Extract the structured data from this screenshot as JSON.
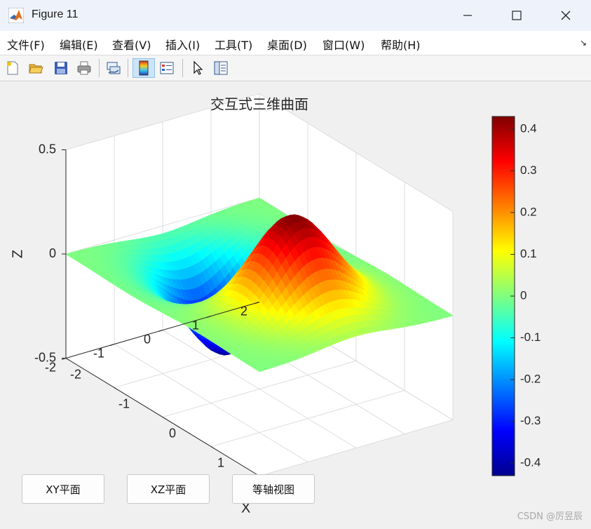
{
  "window": {
    "title": "Figure 11",
    "minimize_glyph": "—",
    "maximize_glyph": "□",
    "close_glyph": "✕"
  },
  "menu": {
    "items": [
      "文件(F)",
      "编辑(E)",
      "查看(V)",
      "插入(I)",
      "工具(T)",
      "桌面(D)",
      "窗口(W)",
      "帮助(H)"
    ],
    "corner_glyph": "↘"
  },
  "toolbar": {
    "icons": [
      "new-figure-icon",
      "open-icon",
      "save-icon",
      "print-icon",
      "link-plot-icon",
      "colorbar-icon",
      "legend-icon",
      "pointer-icon",
      "property-inspector-icon"
    ],
    "active": "colorbar-icon"
  },
  "chart_data": {
    "type": "surface",
    "title": "交互式三维曲面",
    "xlabel": "X",
    "ylabel": "",
    "zlabel": "Z",
    "function": "z = x * exp(-x^2 - y^2)",
    "xlim": [
      -2,
      2
    ],
    "ylim": [
      -2,
      2
    ],
    "zlim": [
      -0.5,
      0.5
    ],
    "x_ticks": [
      "-2",
      "-1",
      "0",
      "1",
      "2"
    ],
    "y_ticks": [
      "-2",
      "-1",
      "0",
      "1",
      "2"
    ],
    "z_ticks": [
      "-0.5",
      "0",
      "0.5"
    ],
    "colormap": "jet",
    "colorbar": {
      "ticks": [
        "0.4",
        "0.3",
        "0.2",
        "0.1",
        "0",
        "-0.1",
        "-0.2",
        "-0.3",
        "-0.4"
      ],
      "range": [
        -0.43,
        0.43
      ]
    },
    "grid": true,
    "view": "3d"
  },
  "buttons": {
    "xy": "XY平面",
    "xz": "XZ平面",
    "axis_equal": "等轴视图"
  },
  "watermark": "CSDN @厉昱辰"
}
